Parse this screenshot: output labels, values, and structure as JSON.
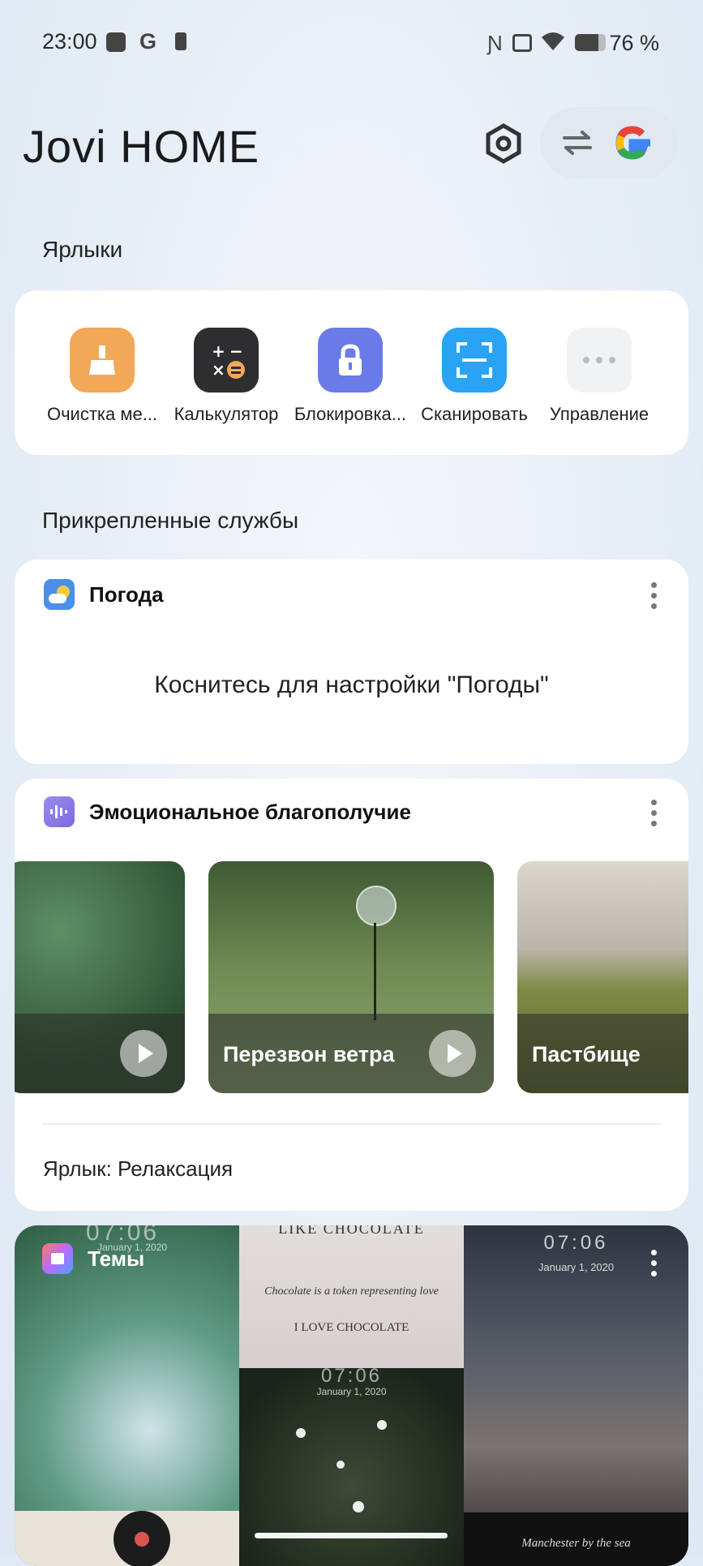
{
  "status_bar": {
    "time": "23:00",
    "battery": "76 %"
  },
  "header": {
    "brand": "Jovi HOME"
  },
  "shortcuts": {
    "title": "Ярлыки",
    "items": [
      {
        "label": "Очистка ме...",
        "icon": "broom-icon",
        "color": "#f3a857"
      },
      {
        "label": "Калькулятор",
        "icon": "calculator-icon",
        "color": "#2e2e30"
      },
      {
        "label": "Блокировка...",
        "icon": "lock-icon",
        "color": "#6a7be8"
      },
      {
        "label": "Сканировать",
        "icon": "scan-icon",
        "color": "#2aa3f5"
      },
      {
        "label": "Управление",
        "icon": "more-icon",
        "color": "#f1f2f4"
      }
    ]
  },
  "pinned": {
    "title": "Прикрепленные службы"
  },
  "weather": {
    "title": "Погода",
    "message": "Коснитесь для настройки \"Погоды\""
  },
  "wellbeing": {
    "title": "Эмоциональное благополучие",
    "tiles": [
      {
        "label": ""
      },
      {
        "label": "Перезвон ветра"
      },
      {
        "label": "Пастбище"
      }
    ],
    "shortcut": "Ярлык: Релаксация"
  },
  "themes": {
    "title": "Темы",
    "preview_texts": {
      "clock_a": "07:06",
      "date_a": "January 1, 2020",
      "choc_head": "LIKE CHOCOLATE",
      "choc_line": "Chocolate is a token representing love",
      "choc_love": "I LOVE CHOCOLATE",
      "clock_b": "07:06",
      "date_b": "January 1, 2020",
      "clock_c": "07:06",
      "date_c": "January 1, 2020",
      "manchester": "Manchester by the sea"
    }
  }
}
